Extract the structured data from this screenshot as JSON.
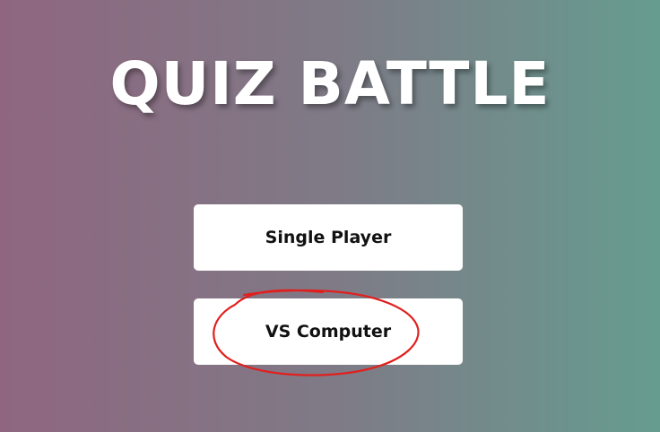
{
  "title": "QUIZ BATTLE",
  "menu": {
    "single_player_label": "Single Player",
    "vs_computer_label": "VS Computer"
  },
  "colors": {
    "gradient_left": "#8f6680",
    "gradient_right": "#669c90",
    "button_bg": "#ffffff",
    "annotation": "#e0201e"
  }
}
